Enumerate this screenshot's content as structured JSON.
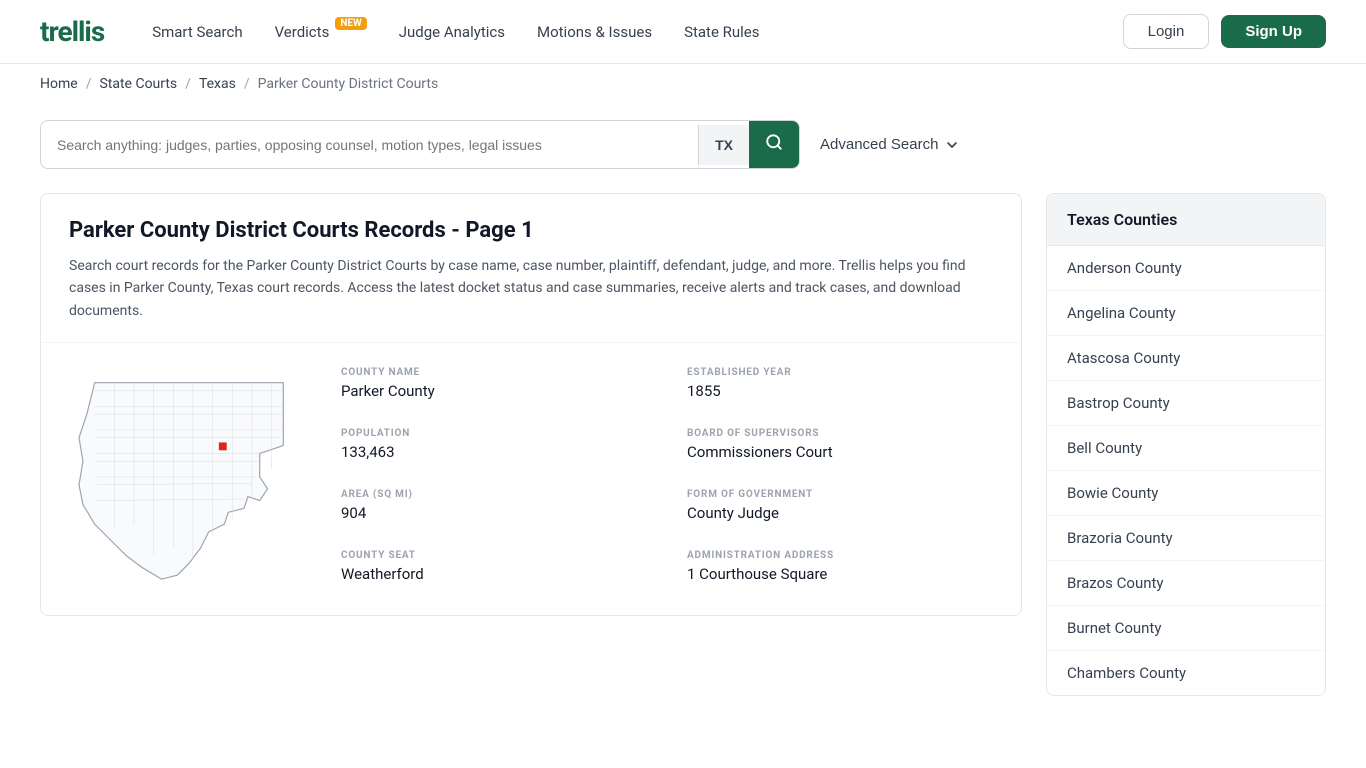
{
  "header": {
    "logo": "trellis",
    "nav": [
      {
        "label": "Smart Search",
        "badge": null
      },
      {
        "label": "Verdicts",
        "badge": "NEW"
      },
      {
        "label": "Judge Analytics",
        "badge": null
      },
      {
        "label": "Motions & Issues",
        "badge": null
      },
      {
        "label": "State Rules",
        "badge": null
      }
    ],
    "login_label": "Login",
    "signup_label": "Sign Up"
  },
  "breadcrumb": {
    "items": [
      "Home",
      "State Courts",
      "Texas",
      "Parker County District Courts"
    ],
    "separators": [
      "/",
      "/",
      "/"
    ]
  },
  "search": {
    "placeholder": "Search anything: judges, parties, opposing counsel, motion types, legal issues",
    "state_code": "TX",
    "advanced_label": "Advanced Search"
  },
  "content": {
    "title": "Parker County District Courts Records - Page 1",
    "description": "Search court records for the Parker County District Courts by case name, case number, plaintiff, defendant, judge, and more. Trellis helps you find cases in Parker County, Texas court records. Access the latest docket status and case summaries, receive alerts and track cases, and download documents.",
    "county_name_label": "COUNTY NAME",
    "county_name": "Parker County",
    "established_year_label": "ESTABLISHED YEAR",
    "established_year": "1855",
    "population_label": "POPULATION",
    "population": "133,463",
    "board_label": "BOARD OF SUPERVISORS",
    "board": "Commissioners Court",
    "area_label": "AREA (SQ MI)",
    "area": "904",
    "form_of_gov_label": "FORM OF GOVERNMENT",
    "form_of_gov": "County Judge",
    "county_seat_label": "COUNTY SEAT",
    "county_seat": "Weatherford",
    "admin_address_label": "ADMINISTRATION ADDRESS",
    "admin_address": "1 Courthouse Square"
  },
  "sidebar": {
    "header": "Texas Counties",
    "items": [
      "Anderson County",
      "Angelina County",
      "Atascosa County",
      "Bastrop County",
      "Bell County",
      "Bowie County",
      "Brazoria County",
      "Brazos County",
      "Burnet County",
      "Chambers County"
    ]
  }
}
